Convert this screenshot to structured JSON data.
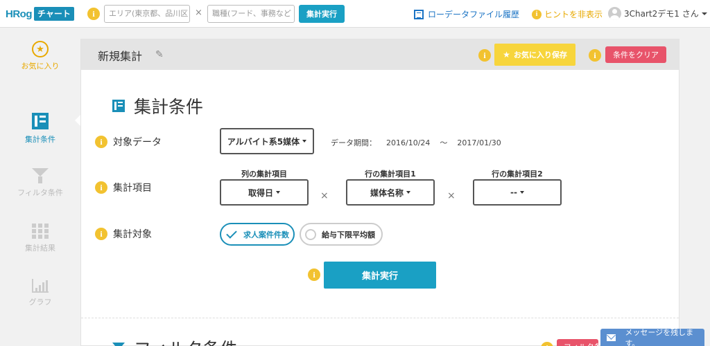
{
  "header": {
    "logo_left": "HRog",
    "logo_right": "チャート",
    "area_placeholder": "エリア(東京都、品川区",
    "job_placeholder": "職種(フード、事務など",
    "times": "×",
    "run_label": "集計実行",
    "history_label": "ローデータファイル履歴",
    "hint_label": "ヒントを非表示",
    "user_label": "3Chart2デモ1 さん"
  },
  "sidebar": {
    "items": [
      {
        "label": "お気に入り",
        "icon": "star-circle-icon"
      },
      {
        "label": "集計条件",
        "icon": "list-icon"
      },
      {
        "label": "フィルタ条件",
        "icon": "funnel-icon"
      },
      {
        "label": "集計結果",
        "icon": "grid-icon"
      },
      {
        "label": "グラフ",
        "icon": "bar-chart-icon"
      }
    ]
  },
  "panel": {
    "title": "新規集計",
    "favorite_button": "お気に入り保存",
    "clear_button": "条件をクリア",
    "section_title": "集計条件",
    "rows": {
      "data_label": "対象データ",
      "data_value": "アルバイト系5媒体",
      "period_label": "データ期間：",
      "period_from": "2016/10/24",
      "period_sep": "〜",
      "period_to": "2017/01/30",
      "items_label": "集計項目",
      "col_header": "列の集計項目",
      "col_value": "取得日",
      "row1_header": "行の集計項目1",
      "row1_value": "媒体名称",
      "row2_header": "行の集計項目2",
      "row2_value": "--",
      "target_label": "集計対象",
      "target_option1": "求人案件件数",
      "target_option2": "給与下限平均額",
      "target_selected": "求人案件件数"
    },
    "run_button": "集計実行",
    "filter_title": "フィルタ条件",
    "filter_clear": "フィルタ条件"
  },
  "message": {
    "label": "メッセージを残します。"
  },
  "colors": {
    "accent": "#1aa0c4",
    "brand": "#1a8fb8",
    "hint": "#f2c230",
    "favorite": "#f7d53c",
    "danger": "#e8536a",
    "link": "#1a73c4"
  }
}
